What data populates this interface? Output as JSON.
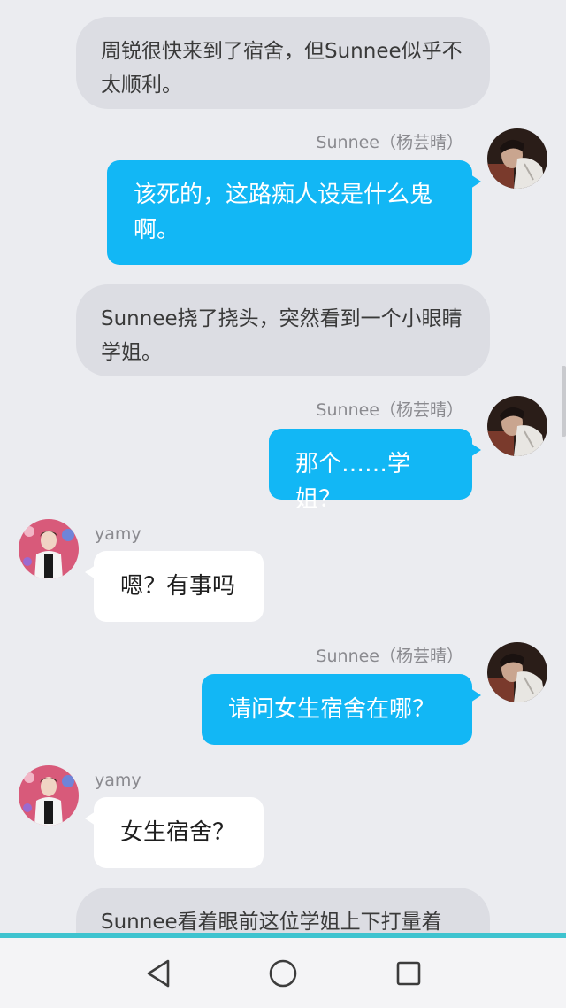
{
  "messages": {
    "n1": "周锐很快来到了宿舍，但Sunnee似乎不太顺利。",
    "m1_name": "Sunnee（杨芸晴）",
    "m1_text": "该死的，这路痴人设是什么鬼啊。",
    "n2": "Sunnee挠了挠头，突然看到一个小眼睛学姐。",
    "m2_name": "Sunnee（杨芸晴）",
    "m2_text": "那个……学姐？",
    "m3_name": "yamy",
    "m3_text": "嗯？有事吗",
    "m4_name": "Sunnee（杨芸晴）",
    "m4_text": "请问女生宿舍在哪？",
    "m5_name": "yamy",
    "m5_text": "女生宿舍？",
    "n3": "Sunnee看着眼前这位学姐上下打量着"
  },
  "icons": {
    "avatar_sunnee": "avatar-sunnee",
    "avatar_yamy": "avatar-yamy",
    "nav_back": "back-triangle-icon",
    "nav_home": "home-circle-icon",
    "nav_recents": "recents-square-icon"
  },
  "colors": {
    "background": "#ebecf0",
    "narration_bubble": "#dcdde3",
    "sent_bubble": "#12b7f5",
    "received_bubble": "#ffffff",
    "accent_line": "#3ec3cf"
  }
}
